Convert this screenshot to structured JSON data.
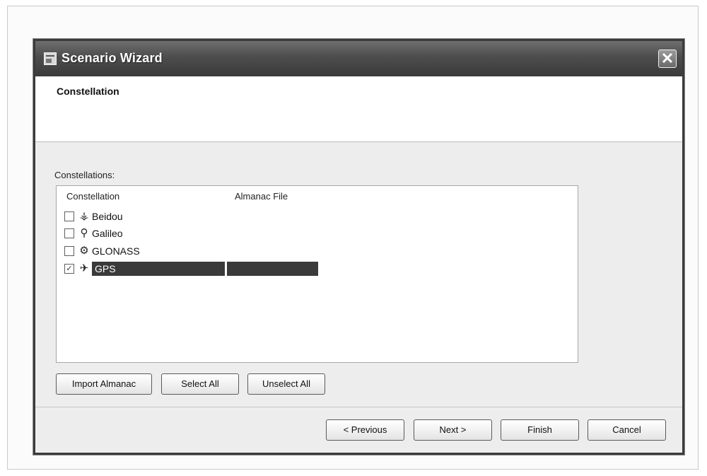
{
  "window": {
    "title": "Scenario Wizard",
    "close_glyph": "✕"
  },
  "header": {
    "title": "Constellation"
  },
  "constellations": {
    "label": "Constellations:",
    "columns": [
      "Constellation",
      "Almanac File"
    ],
    "rows": [
      {
        "name": "Beidou",
        "icon": "beidou-satellite-icon",
        "glyph": "⚶",
        "checked": false,
        "almanac_file": ""
      },
      {
        "name": "Galileo",
        "icon": "galileo-satellite-icon",
        "glyph": "⚲",
        "checked": false,
        "almanac_file": ""
      },
      {
        "name": "GLONASS",
        "icon": "glonass-satellite-icon",
        "glyph": "⚙",
        "checked": false,
        "almanac_file": ""
      },
      {
        "name": "GPS",
        "icon": "gps-satellite-icon",
        "glyph": "✈",
        "checked": true,
        "almanac_file": ""
      }
    ]
  },
  "list_buttons": {
    "import": "Import Almanac",
    "select_all": "Select All",
    "unselect_all": "Unselect All"
  },
  "nav_buttons": {
    "previous": "< Previous",
    "next": "Next >",
    "finish": "Finish",
    "cancel": "Cancel"
  },
  "colors": {
    "selection": "#3a3a3a",
    "titlebar": "#4d4d4d"
  }
}
